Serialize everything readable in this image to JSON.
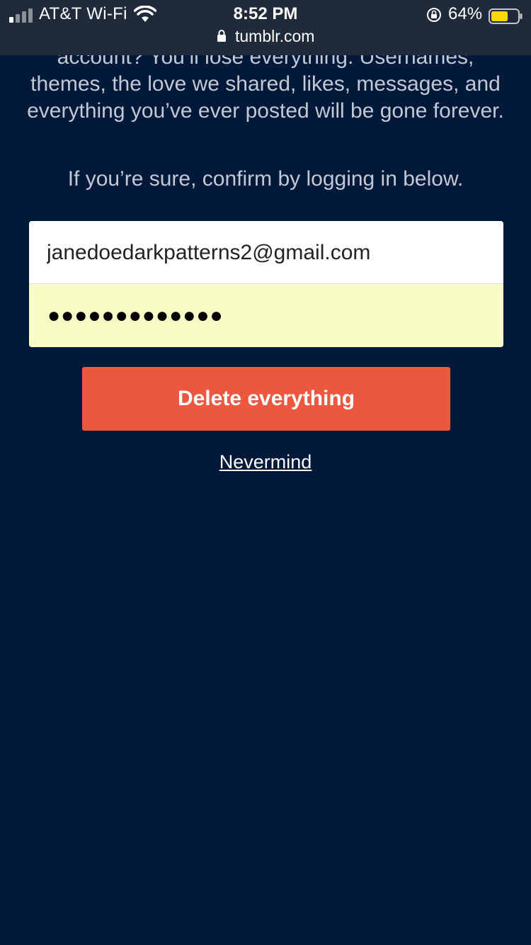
{
  "status_bar": {
    "carrier": "AT&T Wi-Fi",
    "time": "8:52 PM",
    "battery_percent": "64%",
    "battery_color": "#ffd60a",
    "icons": [
      "signal-icon",
      "wifi-icon",
      "rotation-lock-icon",
      "battery-icon"
    ]
  },
  "url_bar": {
    "url": "tumblr.com",
    "icon": "lock-icon"
  },
  "main": {
    "message": "account? You’ll lose everything. Usernames, themes, the love we shared, likes, messages, and everything you’ve ever posted will be gone forever.",
    "confirm_text": "If you’re sure, confirm by logging in below.",
    "email_value": "janedoedarkpatterns2@gmail.com",
    "password_value": "●●●●●●●●●●●●●",
    "delete_button": "Delete everything",
    "nevermind_link": "Nevermind"
  },
  "colors": {
    "background": "#02193a",
    "delete_button": "#ec573f",
    "password_autofill": "#fafcc5"
  }
}
